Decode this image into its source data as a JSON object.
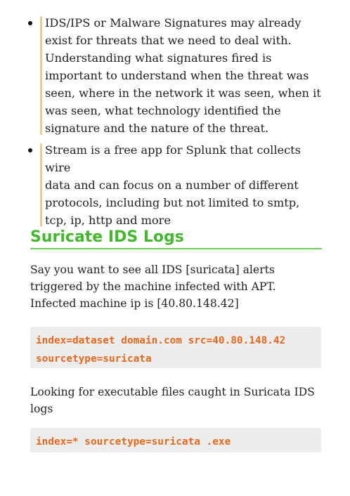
{
  "bullets": [
    {
      "lines": [
        "IDS/IPS or Malware Signatures may already",
        "exist for threats that we need to deal with.",
        "Understanding what signatures fired is",
        "important to understand when the threat was",
        "seen, where in the network it was seen, when it",
        "was seen, what technology identified the",
        "signature and the nature of the threat."
      ]
    },
    {
      "lines": [
        "Stream is a free app for Splunk that collects wire",
        "data and can focus on a number of different",
        "protocols, including but not limited to smtp,",
        "tcp, ip, http and more"
      ]
    }
  ],
  "section": {
    "title": "Suricate IDS Logs",
    "para1": {
      "lines": [
        "Say you want to see all IDS [suricata] alerts",
        "triggered by the machine infected with APT.",
        "Infected machine ip is [40.80.148.42]"
      ]
    },
    "code1": {
      "lines": [
        "index=dataset domain.com src=40.80.148.42",
        "sourcetype=suricata"
      ]
    },
    "para2": {
      "lines": [
        "Looking for executable files caught in Suricata IDS",
        "logs"
      ]
    },
    "code2": {
      "lines": [
        "index=* sourcetype=suricata .exe"
      ]
    }
  },
  "colors": {
    "heading": "#43b82d",
    "code_text": "#e8671a",
    "code_background": "#ededed",
    "bullet_bar": "#f3c996"
  },
  "icons": {
    "bullet": "bullet-dot-icon"
  }
}
